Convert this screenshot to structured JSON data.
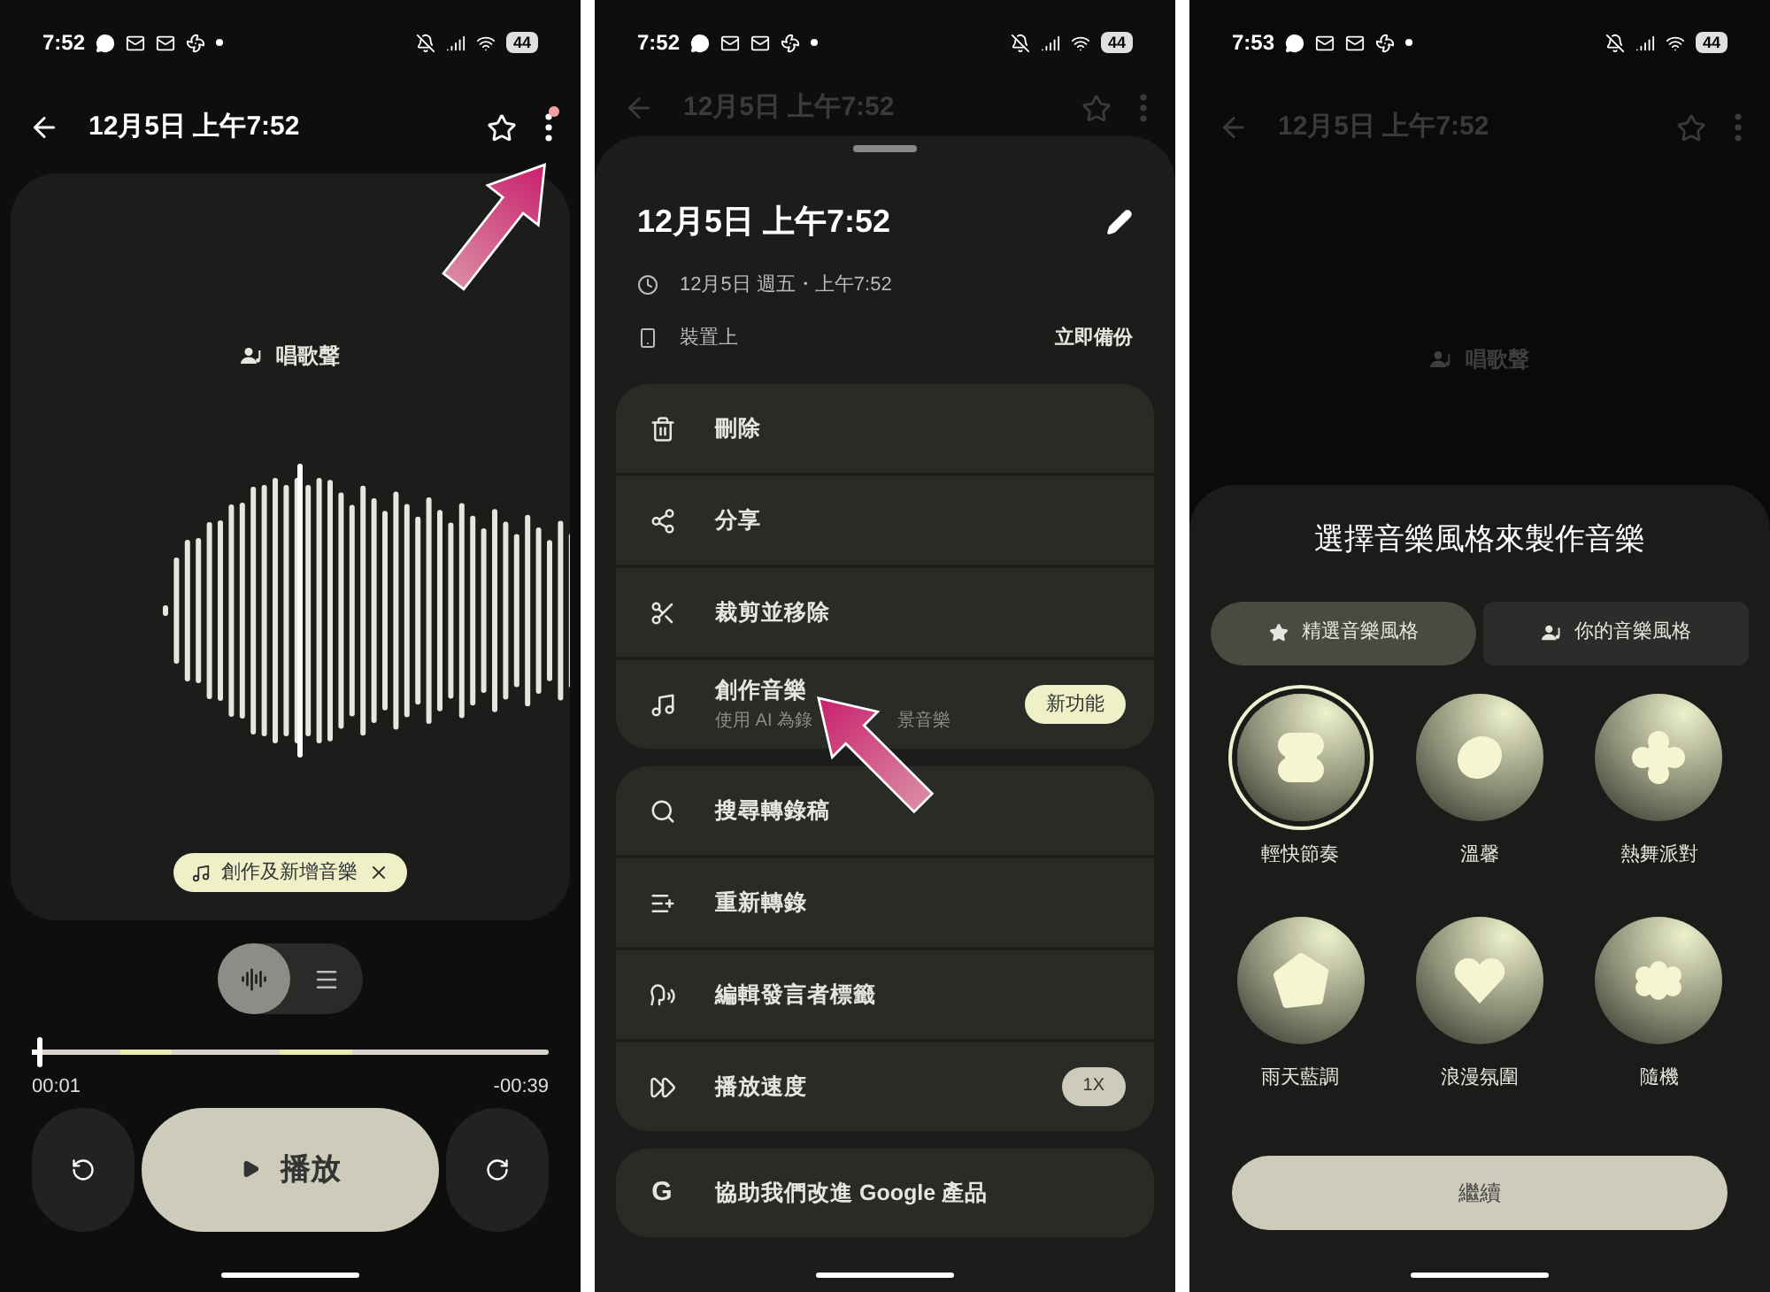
{
  "status_bars": [
    {
      "time": "7:52",
      "battery": "44"
    },
    {
      "time": "7:52",
      "battery": "44"
    },
    {
      "time": "7:53",
      "battery": "44"
    }
  ],
  "player": {
    "title": "12月5日 上午7:52",
    "starred": false,
    "menu_badge": true,
    "speaker_label": "唱歌聲",
    "chip": "創作及新增音樂",
    "view_toggle": [
      {
        "kind": "waveform",
        "selected": true
      },
      {
        "kind": "transcript",
        "selected": false
      }
    ],
    "progress": {
      "level": 0.01
    },
    "elapsed": "00:01",
    "remaining": "-00:39",
    "play_button": "播放"
  },
  "menu": {
    "background_title": "12月5日 上午7:52",
    "title": "12月5日 上午7:52",
    "date_line": "12月5日 週五・上午7:52",
    "storage": "裝置上",
    "backup_action": "立即備份",
    "groups": [
      [
        {
          "label": "刪除"
        },
        {
          "label": "分享"
        },
        {
          "label": "裁剪並移除"
        },
        {
          "label": "創作音樂",
          "subtitle_parts": [
            "使用 AI 為錄",
            "景音樂"
          ],
          "badge": {
            "text": "新功能",
            "kind": "new"
          }
        }
      ],
      [
        {
          "label": "搜尋轉錄稿"
        },
        {
          "label": "重新轉錄"
        },
        {
          "label": "編輯發言者標籤"
        },
        {
          "label": "播放速度",
          "badge": {
            "text": "1X",
            "kind": "value"
          }
        }
      ],
      [
        {
          "glyph": "G",
          "label": "協助我們改進 Google 產品"
        }
      ]
    ]
  },
  "styles": {
    "background_title": "12月5日 上午7:52",
    "background_label": "唱歌聲",
    "title": "選擇音樂風格來製作音樂",
    "tabs": [
      {
        "label": "精選音樂風格",
        "selected": true
      },
      {
        "label": "你的音樂風格",
        "selected": false
      }
    ],
    "options": [
      {
        "label": "輕快節奏",
        "selected": true
      },
      {
        "label": "溫馨",
        "selected": false
      },
      {
        "label": "熱舞派對",
        "selected": false
      },
      {
        "label": "雨天藍調",
        "selected": false
      },
      {
        "label": "浪漫氛圍",
        "selected": false
      },
      {
        "label": "隨機",
        "selected": false
      }
    ],
    "continue_button": "繼續"
  }
}
